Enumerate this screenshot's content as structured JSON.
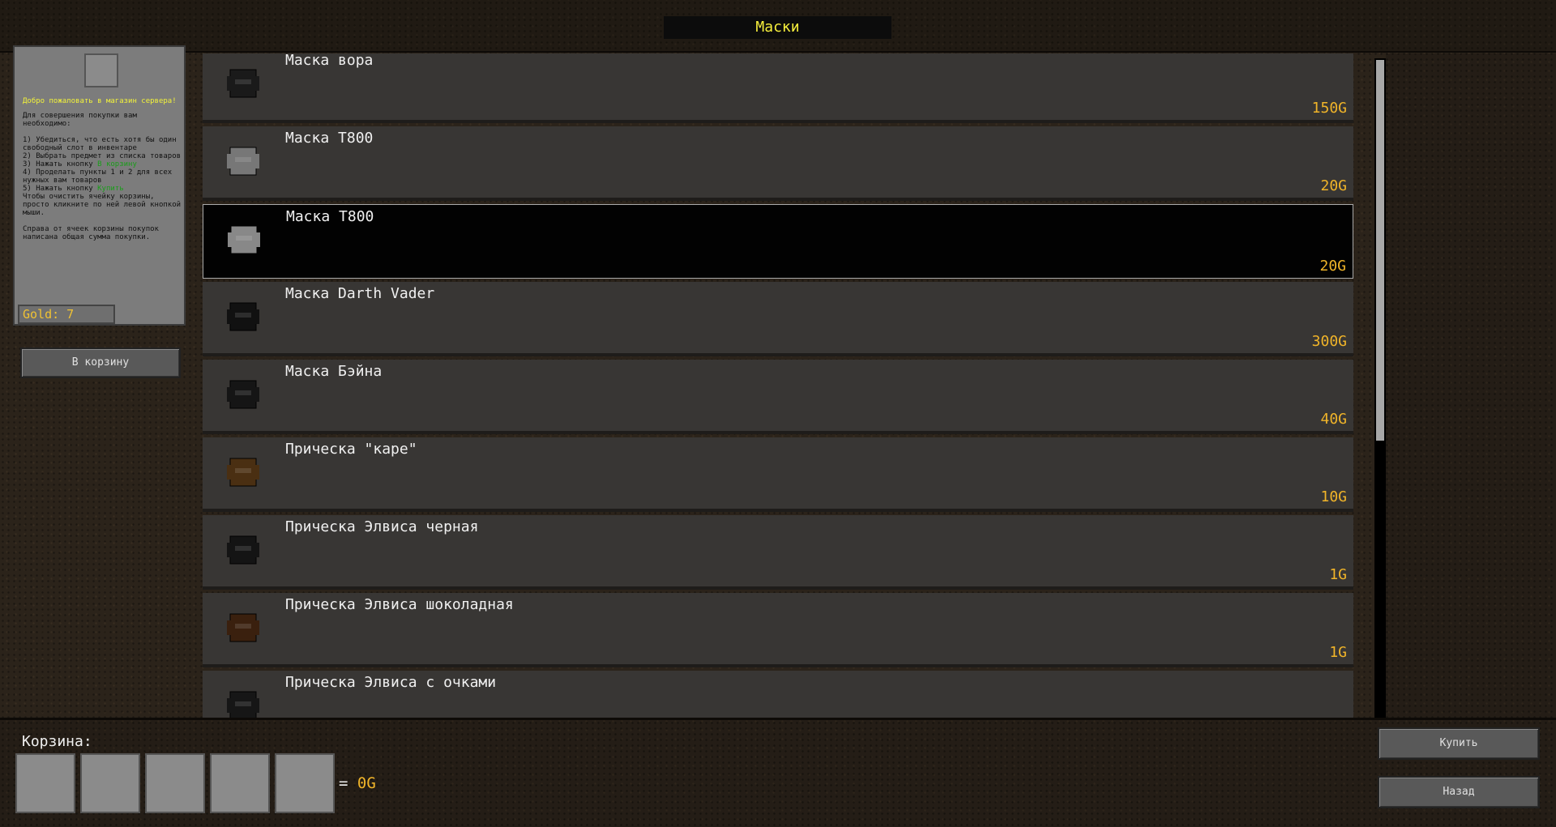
{
  "header": {
    "title": "Маски"
  },
  "info": {
    "welcome": "Добро пожаловать в магазин сервера!",
    "intro": "Для совершения покупки вам необходимо:",
    "step1": "1) Убедиться, что есть хотя бы один свободный слот в инвентаре",
    "step2": "2) Выбрать предмет из списка товаров",
    "step3_prefix": "3) Нажать кнопку ",
    "step3_highlight": "В корзину",
    "step4": "4) Проделать пункты 1 и 2 для всех нужных вам товаров",
    "step5_prefix": "5) Нажать кнопку ",
    "step5_highlight": "Купить",
    "clear_hint": "Чтобы очистить ячейку корзины, просто кликните по ней левой кнопкой мыши.",
    "total_hint": "Справа от ячеек корзины покупок написана общая сумма покупки.",
    "gold": "Gold: 7"
  },
  "buttons": {
    "add_to_cart": "В корзину",
    "buy": "Купить",
    "back": "Назад"
  },
  "items": [
    {
      "name": "Маска вора",
      "price": "150G",
      "icon": "thief-mask-icon",
      "color": "#1a1a1a"
    },
    {
      "name": "Маска T800",
      "price": "20G",
      "icon": "t800-mask-icon",
      "color": "#777777"
    },
    {
      "name": "Маска T800",
      "price": "20G",
      "icon": "t800-mask-icon",
      "color": "#888888",
      "selected": true
    },
    {
      "name": "Маска Darth Vader",
      "price": "300G",
      "icon": "darth-vader-mask-icon",
      "color": "#111111"
    },
    {
      "name": "Маска Бэйна",
      "price": "40G",
      "icon": "bane-mask-icon",
      "color": "#151515"
    },
    {
      "name": "Прическа \"каре\"",
      "price": "10G",
      "icon": "bob-hair-icon",
      "color": "#4a2f12"
    },
    {
      "name": "Прическа Элвиса черная",
      "price": "1G",
      "icon": "elvis-hair-black-icon",
      "color": "#141414"
    },
    {
      "name": "Прическа Элвиса шоколадная",
      "price": "1G",
      "icon": "elvis-hair-chocolate-icon",
      "color": "#3a200e"
    },
    {
      "name": "Прическа Элвиса с очками",
      "price": "",
      "icon": "elvis-hair-glasses-icon",
      "color": "#161616"
    }
  ],
  "cart": {
    "label": "Корзина:",
    "equals": "=",
    "total": "0G"
  }
}
